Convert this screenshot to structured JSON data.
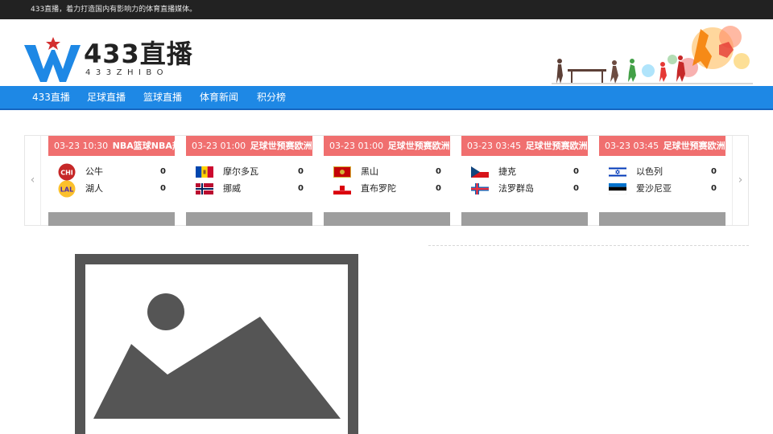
{
  "topbar": {
    "tagline": "433直播，着力打造国内有影响力的体育直播媒体。"
  },
  "logo": {
    "title": "433直播",
    "subtitle": "433ZHIBO"
  },
  "nav": {
    "items": [
      "433直播",
      "足球直播",
      "篮球直播",
      "体育新闻",
      "积分榜"
    ]
  },
  "matches": [
    {
      "time": "03-23 10:30",
      "league": "NBA篮球NBA热身赛",
      "home": "公牛",
      "away": "湖人",
      "home_score": "0",
      "away_score": "0"
    },
    {
      "time": "03-23 01:00",
      "league": "足球世预赛欧洲区",
      "home": "摩尔多瓦",
      "away": "挪威",
      "home_score": "0",
      "away_score": "0"
    },
    {
      "time": "03-23 01:00",
      "league": "足球世预赛欧洲区",
      "home": "黑山",
      "away": "直布罗陀",
      "home_score": "0",
      "away_score": "0"
    },
    {
      "time": "03-23 03:45",
      "league": "足球世预赛欧洲区",
      "home": "捷克",
      "away": "法罗群岛",
      "home_score": "0",
      "away_score": "0"
    },
    {
      "time": "03-23 03:45",
      "league": "足球世预赛欧洲区",
      "home": "以色列",
      "away": "爱沙尼亚",
      "home_score": "0",
      "away_score": "0"
    }
  ],
  "logo_badges": {
    "chi": "CHI",
    "lal": "LAL"
  },
  "colors": {
    "nav": "#1e88e5",
    "card_head": "#f06f6f",
    "topbar": "#222222"
  }
}
